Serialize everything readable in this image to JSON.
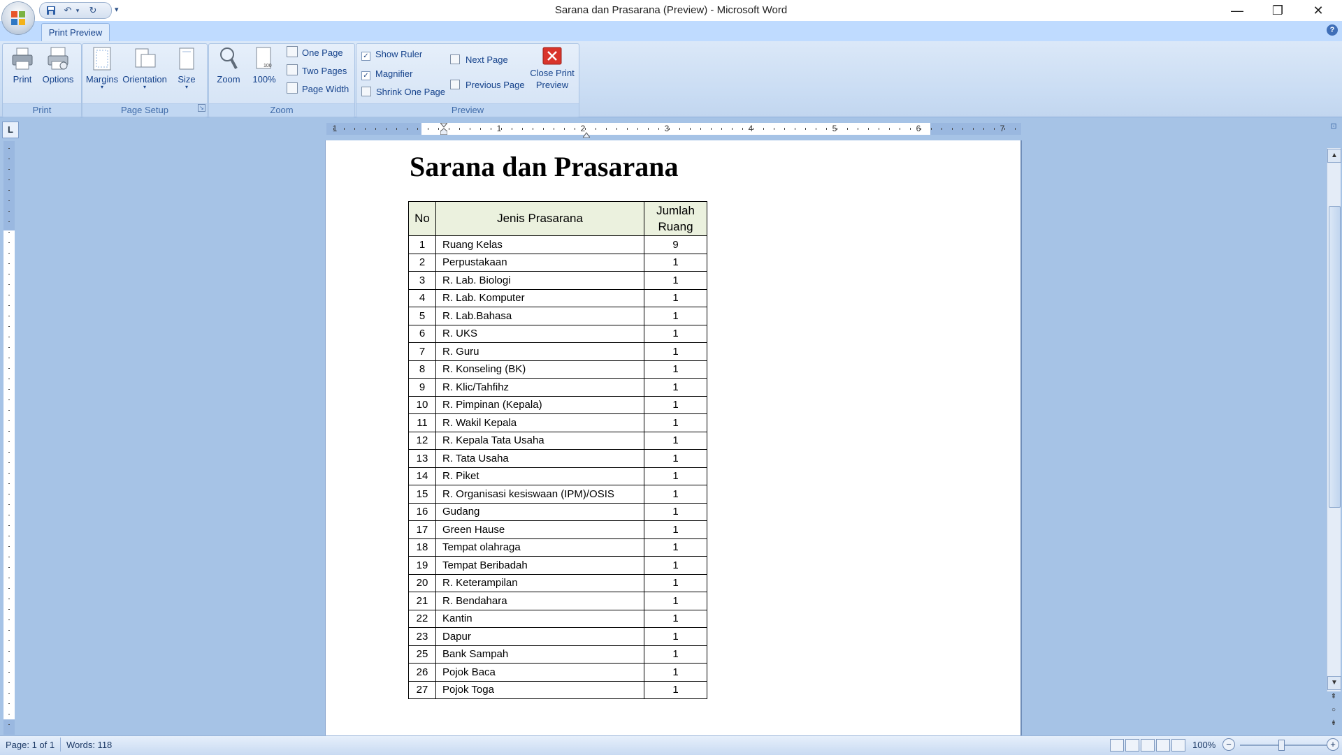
{
  "window": {
    "title": "Sarana dan Prasarana (Preview) - Microsoft Word",
    "controls": {
      "minimize": "—",
      "restore": "❐",
      "close": "✕"
    }
  },
  "quick_access": {
    "save_icon": "save-icon",
    "undo_icon": "undo-icon",
    "redo_icon": "redo-icon",
    "customize": "▾"
  },
  "ribbon": {
    "active_tab": "Print Preview",
    "groups": {
      "print": {
        "label": "Print",
        "print_label": "Print",
        "options_label": "Options"
      },
      "page_setup": {
        "label": "Page Setup",
        "margins_label": "Margins",
        "orientation_label": "Orientation",
        "size_label": "Size"
      },
      "zoom": {
        "label": "Zoom",
        "zoom_label": "Zoom",
        "hundred_label": "100%",
        "one_page": "One Page",
        "two_pages": "Two Pages",
        "page_width": "Page Width"
      },
      "preview": {
        "label": "Preview",
        "show_ruler": "Show Ruler",
        "show_ruler_checked": true,
        "magnifier": "Magnifier",
        "magnifier_checked": true,
        "shrink_one_page": "Shrink One Page",
        "next_page": "Next Page",
        "previous_page": "Previous Page",
        "close_line1": "Close Print",
        "close_line2": "Preview"
      }
    }
  },
  "ruler": {
    "corner": "L",
    "numbers": [
      "1",
      "1",
      "2",
      "3",
      "4",
      "5",
      "6",
      "7"
    ]
  },
  "document": {
    "title": "Sarana dan Prasarana",
    "table": {
      "headers": {
        "no": "No",
        "name": "Jenis Prasarana",
        "qty_line1": "Jumlah",
        "qty_line2": "Ruang"
      },
      "rows": [
        {
          "no": "1",
          "name": "Ruang Kelas",
          "qty": "9"
        },
        {
          "no": "2",
          "name": "Perpustakaan",
          "qty": "1"
        },
        {
          "no": "3",
          "name": "R. Lab. Biologi",
          "qty": "1"
        },
        {
          "no": "4",
          "name": "R. Lab. Komputer",
          "qty": "1"
        },
        {
          "no": "5",
          "name": "R. Lab.Bahasa",
          "qty": "1"
        },
        {
          "no": "6",
          "name": "R. UKS",
          "qty": "1"
        },
        {
          "no": "7",
          "name": "R. Guru",
          "qty": "1"
        },
        {
          "no": "8",
          "name": "R. Konseling (BK)",
          "qty": "1"
        },
        {
          "no": "9",
          "name": "R. Klic/Tahfihz",
          "qty": "1"
        },
        {
          "no": "10",
          "name": "R. Pimpinan (Kepala)",
          "qty": "1"
        },
        {
          "no": "11",
          "name": "R. Wakil Kepala",
          "qty": "1"
        },
        {
          "no": "12",
          "name": "R. Kepala Tata Usaha",
          "qty": "1"
        },
        {
          "no": "13",
          "name": "R.  Tata Usaha",
          "qty": "1"
        },
        {
          "no": "14",
          "name": "R. Piket",
          "qty": "1"
        },
        {
          "no": "15",
          "name": "R. Organisasi kesiswaan (IPM)/OSIS",
          "qty": "1"
        },
        {
          "no": "16",
          "name": "Gudang",
          "qty": "1"
        },
        {
          "no": "17",
          "name": "Green Hause",
          "qty": "1"
        },
        {
          "no": "18",
          "name": "Tempat olahraga",
          "qty": "1"
        },
        {
          "no": "19",
          "name": "Tempat Beribadah",
          "qty": "1"
        },
        {
          "no": "20",
          "name": "R. Keterampilan",
          "qty": "1"
        },
        {
          "no": "21",
          "name": "R. Bendahara",
          "qty": "1"
        },
        {
          "no": "22",
          "name": "Kantin",
          "qty": "1"
        },
        {
          "no": "23",
          "name": "Dapur",
          "qty": "1"
        },
        {
          "no": "25",
          "name": "Bank Sampah",
          "qty": "1"
        },
        {
          "no": "26",
          "name": "Pojok Baca",
          "qty": "1"
        },
        {
          "no": "27",
          "name": "Pojok Toga",
          "qty": "1"
        }
      ]
    }
  },
  "status_bar": {
    "page": "Page: 1 of 1",
    "words": "Words: 118",
    "zoom": "100%",
    "zoom_minus": "−",
    "zoom_plus": "+"
  },
  "colors": {
    "ribbon": "#dbe8f8",
    "workspace": "#a6c3e6",
    "table_header": "#ebf1de",
    "close_preview": "#d9342b"
  }
}
